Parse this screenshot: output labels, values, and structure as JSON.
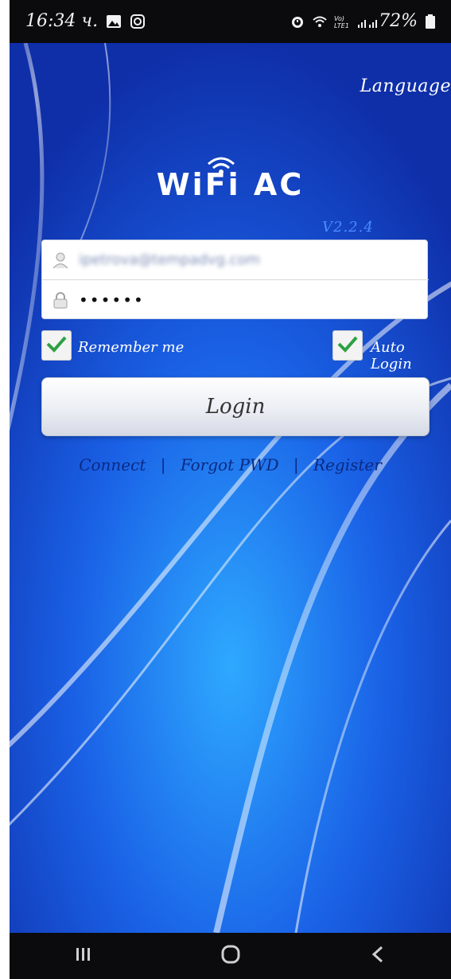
{
  "status_bar": {
    "time": "16:34 ч.",
    "battery_percent": "72%",
    "icons": [
      "gallery-icon",
      "instagram-icon",
      "alarm-icon",
      "wifi-icon",
      "volte-icon",
      "signal-icon",
      "battery-icon"
    ]
  },
  "header": {
    "language_label": "Language"
  },
  "app": {
    "title": "WiFi AC",
    "version": "V2.2.4"
  },
  "login": {
    "email_value": "ipetrova@tempadvg.com",
    "password_value": "••••••",
    "remember_label": "Remember me",
    "auto_login_label": "Auto Login",
    "login_button_label": "Login",
    "remember_checked": true,
    "auto_login_checked": true
  },
  "links": {
    "connect": "Connect",
    "separator_1": "|",
    "forgot": "Forgot PWD",
    "separator_2": "|",
    "register": "Register"
  },
  "colors": {
    "background": "#1b43c9",
    "link_text": "#0b2a83",
    "version_text": "#4b8bff",
    "check_green": "#2ea043"
  },
  "nav_bar": {
    "buttons": [
      "recent-apps-icon",
      "home-icon",
      "back-icon"
    ]
  }
}
